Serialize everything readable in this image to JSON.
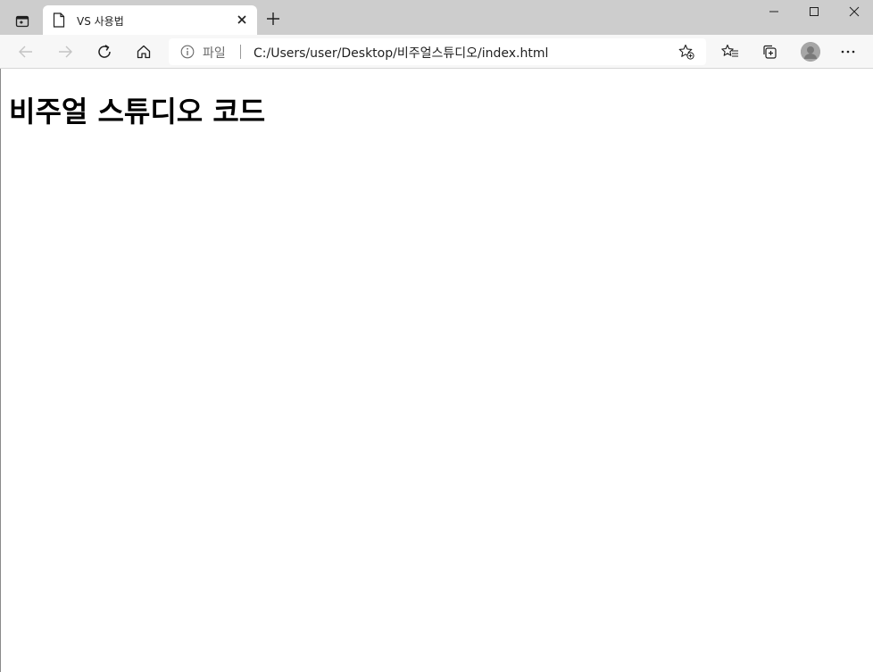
{
  "tab": {
    "title": "VS 사용법"
  },
  "address_bar": {
    "scheme_label": "파일",
    "url": "C:/Users/user/Desktop/비주얼스튜디오/index.html"
  },
  "page": {
    "heading": "비주얼 스튜디오 코드"
  },
  "colors": {
    "tabstrip": "#cdcdcd",
    "toolbar": "#f7f7f7",
    "page_background": "#ffffff",
    "text": "#000000"
  },
  "icons": {
    "tab_actions": "tab-actions-icon",
    "favicon": "page-icon",
    "close": "close-icon",
    "new_tab": "plus-icon",
    "back": "arrow-left-icon",
    "forward": "arrow-right-icon",
    "refresh": "refresh-icon",
    "home": "home-icon",
    "info": "info-icon",
    "add_favorite": "star-plus-icon",
    "favorites": "favorites-icon",
    "collections": "collections-icon",
    "profile": "avatar",
    "menu": "more-icon"
  }
}
